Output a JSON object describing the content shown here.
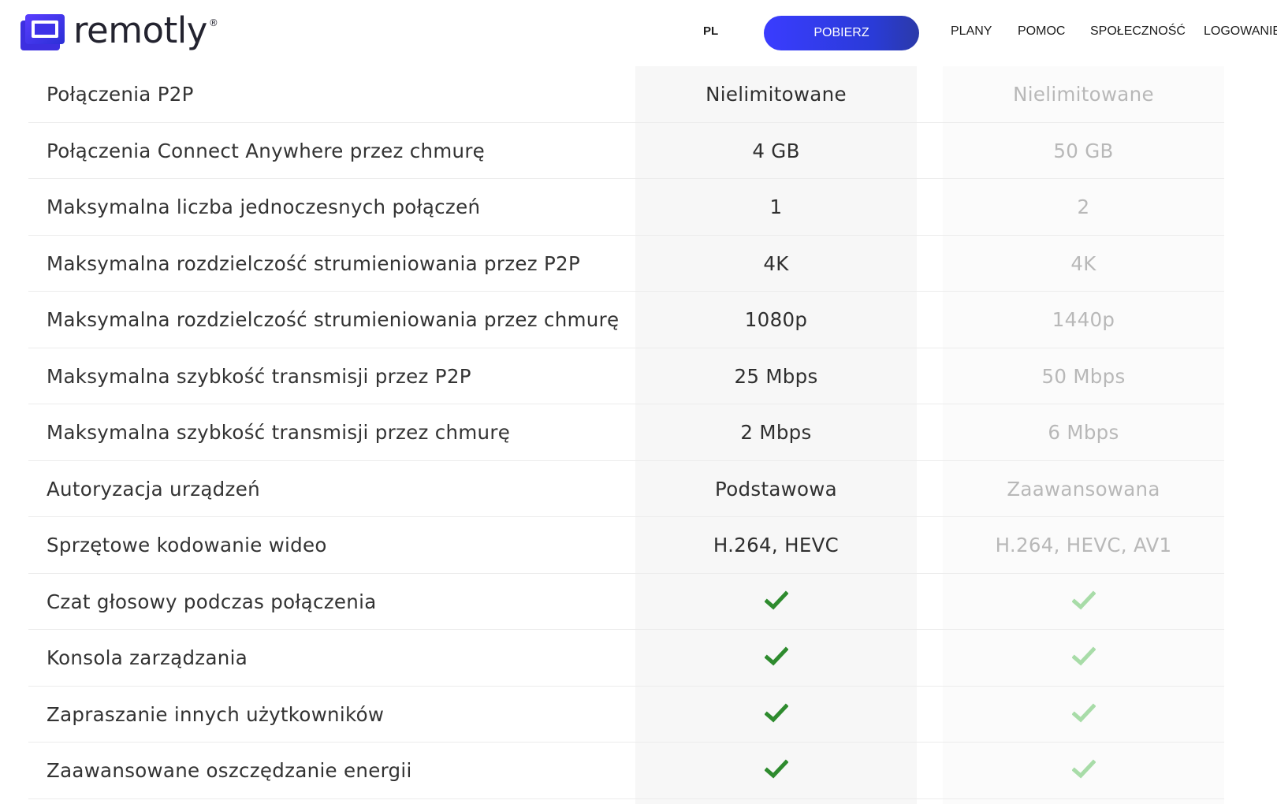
{
  "header": {
    "logo_text": "remotly",
    "logo_reg": "®",
    "lang": "PL",
    "download_label": "POBIERZ",
    "nav": [
      "PLANY",
      "POMOC",
      "SPOŁECZNOŚĆ",
      "LOGOWANIE"
    ]
  },
  "colors": {
    "brand": "#3a3cff",
    "check_primary": "#2e8b2e",
    "check_faded": "#a8dca8"
  },
  "table": {
    "rows": [
      {
        "label": "Połączenia P2P",
        "v1": "Nielimitowane",
        "v2": "Nielimitowane"
      },
      {
        "label": "Połączenia Connect Anywhere przez chmurę",
        "v1": "4 GB",
        "v2": "50 GB"
      },
      {
        "label": "Maksymalna liczba jednoczesnych połączeń",
        "v1": "1",
        "v2": "2"
      },
      {
        "label": "Maksymalna rozdzielczość strumieniowania przez P2P",
        "v1": "4K",
        "v2": "4K"
      },
      {
        "label": "Maksymalna rozdzielczość strumieniowania przez chmurę",
        "v1": "1080p",
        "v2": "1440p"
      },
      {
        "label": "Maksymalna szybkość transmisji przez P2P",
        "v1": "25 Mbps",
        "v2": "50 Mbps"
      },
      {
        "label": "Maksymalna szybkość transmisji przez chmurę",
        "v1": "2 Mbps",
        "v2": "6 Mbps"
      },
      {
        "label": "Autoryzacja urządzeń",
        "v1": "Podstawowa",
        "v2": "Zaawansowana"
      },
      {
        "label": "Sprzętowe kodowanie wideo",
        "v1": "H.264, HEVC",
        "v2": "H.264, HEVC, AV1"
      },
      {
        "label": "Czat głosowy podczas połączenia",
        "v1": "check-icon",
        "v2": "check-icon"
      },
      {
        "label": "Konsola zarządzania",
        "v1": "check-icon",
        "v2": "check-icon"
      },
      {
        "label": "Zapraszanie innych użytkowników",
        "v1": "check-icon",
        "v2": "check-icon"
      },
      {
        "label": "Zaawansowane oszczędzanie energii",
        "v1": "check-icon",
        "v2": "check-icon"
      }
    ]
  }
}
